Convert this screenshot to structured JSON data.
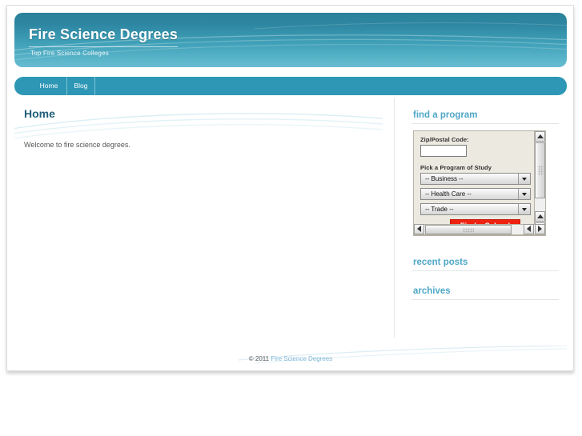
{
  "site": {
    "title": "Fire Science Degrees",
    "tagline": "Top Fire Science Colleges"
  },
  "nav": {
    "items": [
      {
        "label": "Home"
      },
      {
        "label": "Blog"
      }
    ]
  },
  "main": {
    "page_title": "Home",
    "body_text": "Welcome to fire science degrees."
  },
  "sidebar": {
    "find_program": {
      "heading": "find a program",
      "zip_label": "Zip/Postal Code:",
      "zip_value": "",
      "zip_placeholder": "",
      "study_label": "Pick a Program of Study",
      "selects": [
        {
          "value": "-- Business --"
        },
        {
          "value": "-- Health Care --"
        },
        {
          "value": "-- Trade --"
        }
      ],
      "submit_label": "Find a School"
    },
    "recent_posts": {
      "heading": "recent posts"
    },
    "archives": {
      "heading": "archives"
    }
  },
  "footer": {
    "copyright_prefix": "© 2011 ",
    "brand": "Fire Science Degrees"
  },
  "colors": {
    "header_teal_dark": "#2a8099",
    "header_teal_light": "#68bdd2",
    "nav_teal": "#2e97b5",
    "heading_blue": "#1f5f7a",
    "sidebar_heading_blue": "#4fa7c6",
    "button_red": "#ee2211",
    "widget_bg": "#ebe9e0"
  }
}
